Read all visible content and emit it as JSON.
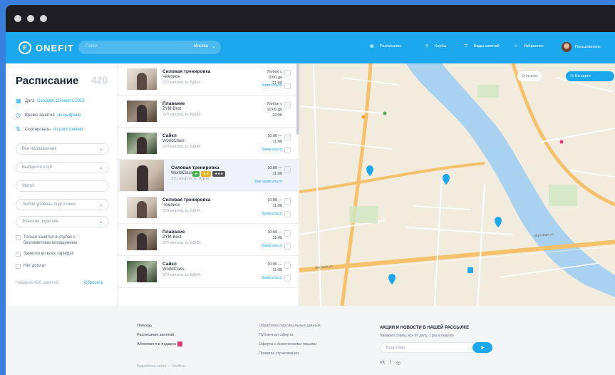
{
  "header": {
    "logo": "ONEFIT",
    "search_placeholder": "Поиск",
    "city": "Москва",
    "nav": [
      {
        "label": "Расписание",
        "icon": "calendar-icon"
      },
      {
        "label": "Клубы",
        "icon": "dumbbell-icon"
      },
      {
        "label": "Виды занятий",
        "icon": "activity-icon"
      },
      {
        "label": "Избранное",
        "icon": "star-icon"
      },
      {
        "label": "Пользователь",
        "icon": "avatar"
      }
    ]
  },
  "sidebar": {
    "title": "Расписание",
    "count": "420",
    "date_label": "Дата",
    "date_value": "Сегодня, 25 марта 2018",
    "time_label": "Время занятия",
    "time_value": "не выбрано",
    "sort_label": "Сортировать",
    "sort_value": "по расстоянию",
    "selects": [
      "Все направления",
      "Выберите клуб",
      "Метро",
      "Любой уровень подготовки",
      "Женские, мужские"
    ],
    "checks": [
      "Только занятия в клубах с безлимитным посещением",
      "Занятия во всех тарифах",
      "Нет доплат"
    ],
    "found": "Найдено 420 занятий",
    "reset": "Сбросить"
  },
  "list": [
    {
      "title": "Силовая тренировка",
      "club": "Чемпион",
      "distance": "370 метров, м. ВДНХ",
      "time_top": "Любое с",
      "time_mid": "9:00 до",
      "time_bot": "21:00",
      "action": "Записаться",
      "active": false
    },
    {
      "title": "Плавание",
      "club": "ZYM Best",
      "distance": "370 метров, м. ВДНХ",
      "time_top": "Любое с",
      "time_mid": "10:00 до",
      "time_bot": "22:00",
      "action": "",
      "active": false
    },
    {
      "title": "Сайкл",
      "club": "WorldClass",
      "distance": "370 метров, м. ВДНХ",
      "time_top": "10:00 —",
      "time_mid": "11:00",
      "time_bot": "",
      "action": "Записаться",
      "active": false
    },
    {
      "title": "Силовая тренировка",
      "club": "WorldClass",
      "distance": "370 метров, м. ВДНХ",
      "time_top": "10:00 —",
      "time_mid": "11:00",
      "time_bot": "",
      "action": "Как записаться",
      "active": true
    },
    {
      "title": "Силовая тренировка",
      "club": "Чемпион",
      "distance": "370 метров, м. ВДНХ",
      "time_top": "10:00 —",
      "time_mid": "11:00",
      "time_bot": "",
      "action": "Записаться",
      "active": false
    },
    {
      "title": "Плавание",
      "club": "ZYM Best",
      "distance": "370 метров, м. ВДНХ",
      "time_top": "10:00 —",
      "time_mid": "11:00",
      "time_bot": "",
      "action": "Записаться",
      "active": false
    },
    {
      "title": "Сайкл",
      "club": "WorldClass",
      "distance": "370 метров, м. ВДНХ",
      "time_top": "10:00 —",
      "time_mid": "11:00",
      "time_bot": "",
      "action": "Записаться",
      "active": false
    }
  ],
  "map": {
    "btn_list": "Списком",
    "btn_map": "На карте",
    "street1": "Житная ул.",
    "street2": "Валовая ул."
  },
  "footer": {
    "col1": [
      "Помощь",
      "Расписание занятий",
      "Абонемент в подарок"
    ],
    "col2": [
      "Обработка персональных данных",
      "Публичная оферта",
      "Оферта с физическими лицами",
      "Правила страхования"
    ],
    "news_title": "АКЦИИ И НОВОСТИ В НАШЕЙ РАССЫЛКЕ",
    "news_sub": "Никакого спама, все по делу, 1 раз в неделю",
    "email_placeholder": "Ваш email",
    "copyright": "Разработка сайта — Onefit.ru"
  },
  "colors": {
    "accent": "#1da8ee",
    "pink": "#e2367a",
    "frame": "#3a7fdc"
  }
}
